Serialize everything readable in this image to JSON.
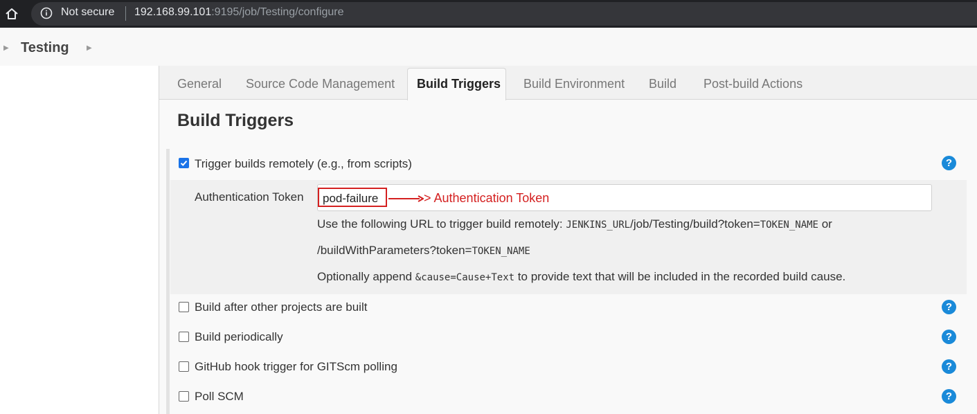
{
  "browser": {
    "security_label": "Not secure",
    "url_host": "192.168.99.101",
    "url_path": ":9195/job/Testing/configure"
  },
  "breadcrumb": {
    "item": "Testing"
  },
  "tabs": [
    {
      "label": "General"
    },
    {
      "label": "Source Code Management"
    },
    {
      "label": "Build Triggers",
      "active": true
    },
    {
      "label": "Build Environment"
    },
    {
      "label": "Build"
    },
    {
      "label": "Post-build Actions"
    }
  ],
  "section": {
    "title": "Build Triggers",
    "options": [
      {
        "label": "Trigger builds remotely (e.g., from scripts)",
        "checked": true
      },
      {
        "label": "Build after other projects are built",
        "checked": false
      },
      {
        "label": "Build periodically",
        "checked": false
      },
      {
        "label": "GitHub hook trigger for GITScm polling",
        "checked": false
      },
      {
        "label": "Poll SCM",
        "checked": false
      }
    ],
    "token": {
      "label": "Authentication Token",
      "value": "pod-failure",
      "annotation": "> Authentication Token",
      "desc1_prefix": "Use the following URL to trigger build remotely: ",
      "desc1_code": "JENKINS_URL",
      "desc1_mid": "/job/Testing/build?token=",
      "desc1_code2": "TOKEN_NAME",
      "desc1_suffix": " or",
      "desc2_prefix": "/buildWithParameters?token=",
      "desc2_code": "TOKEN_NAME",
      "desc3_prefix": "Optionally append ",
      "desc3_code": "&cause=Cause+Text",
      "desc3_suffix": " to provide text that will be included in the recorded build cause."
    },
    "help_glyph": "?"
  },
  "colors": {
    "accent": "#1a8ad9",
    "annotation": "#d42020",
    "checkbox": "#1a73e8"
  }
}
